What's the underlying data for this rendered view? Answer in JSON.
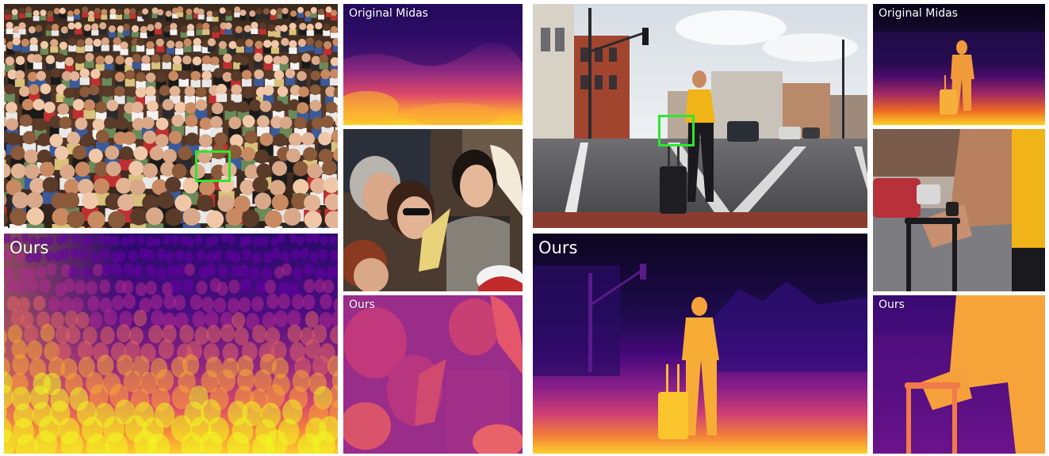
{
  "figure": {
    "left_example": {
      "original_label": "Original Midas",
      "ours_big_label": "Ours",
      "ours_small_label": "Ours"
    },
    "right_example": {
      "original_label": "Original Midas",
      "ours_big_label": "Ours",
      "ours_small_label": "Ours"
    },
    "highlight_color": "#2ee62e",
    "colormap": [
      "#0d0887",
      "#6a00a8",
      "#b12a90",
      "#e16462",
      "#fca636",
      "#f0f921"
    ]
  }
}
